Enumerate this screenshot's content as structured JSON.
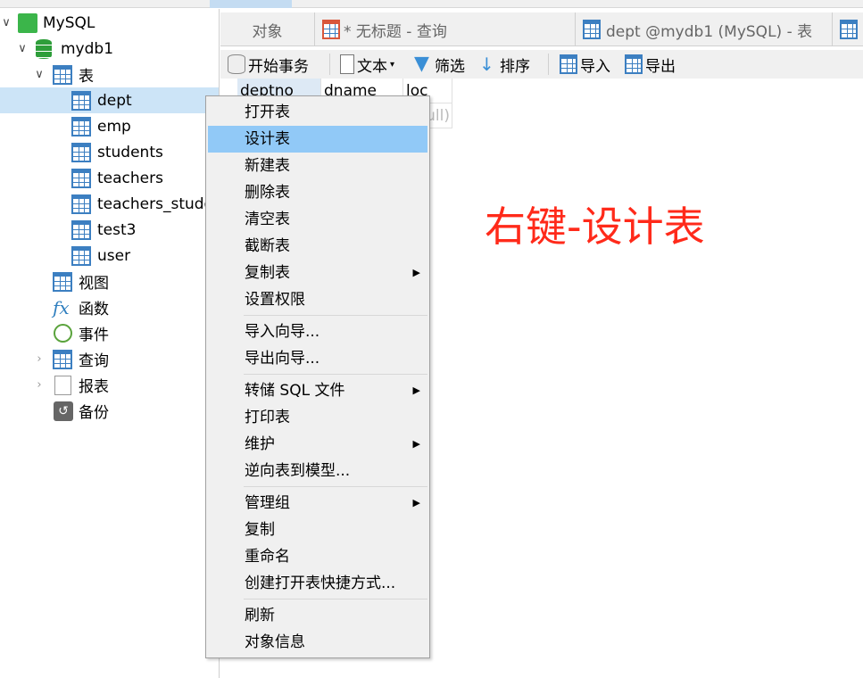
{
  "sidebar": {
    "connection": "MySQL",
    "database": "mydb1",
    "tables_group": "表",
    "tables": [
      "dept",
      "emp",
      "students",
      "teachers",
      "teachers_stude",
      "test3",
      "user"
    ],
    "groups": [
      "视图",
      "函数",
      "事件",
      "查询",
      "报表",
      "备份"
    ]
  },
  "tabs": {
    "objects": "对象",
    "query": "* 无标题 - 查询",
    "table": "dept @mydb1 (MySQL) - 表"
  },
  "toolbar": {
    "begin_transaction": "开始事务",
    "text": "文本",
    "filter": "筛选",
    "sort": "排序",
    "import": "导入",
    "export": "导出"
  },
  "grid": {
    "columns": [
      "deptno",
      "dname",
      "loc"
    ],
    "row_value": "(Null)"
  },
  "context_menu": {
    "items": [
      {
        "label": "打开表"
      },
      {
        "label": "设计表",
        "highlighted": true
      },
      {
        "label": "新建表"
      },
      {
        "label": "删除表"
      },
      {
        "label": "清空表"
      },
      {
        "label": "截断表"
      },
      {
        "label": "复制表",
        "submenu": true
      },
      {
        "label": "设置权限"
      },
      {
        "label": "导入向导..."
      },
      {
        "label": "导出向导..."
      },
      {
        "label": "转储 SQL 文件",
        "submenu": true
      },
      {
        "label": "打印表"
      },
      {
        "label": "维护",
        "submenu": true
      },
      {
        "label": "逆向表到模型..."
      },
      {
        "label": "管理组",
        "submenu": true
      },
      {
        "label": "复制"
      },
      {
        "label": "重命名"
      },
      {
        "label": "创建打开表快捷方式..."
      },
      {
        "label": "刷新"
      },
      {
        "label": "对象信息"
      }
    ]
  },
  "annotation": "右键-设计表",
  "colors": {
    "selection": "#cce4f7",
    "menu_highlight": "#91c9f7",
    "annotation": "#ff2a1a"
  }
}
